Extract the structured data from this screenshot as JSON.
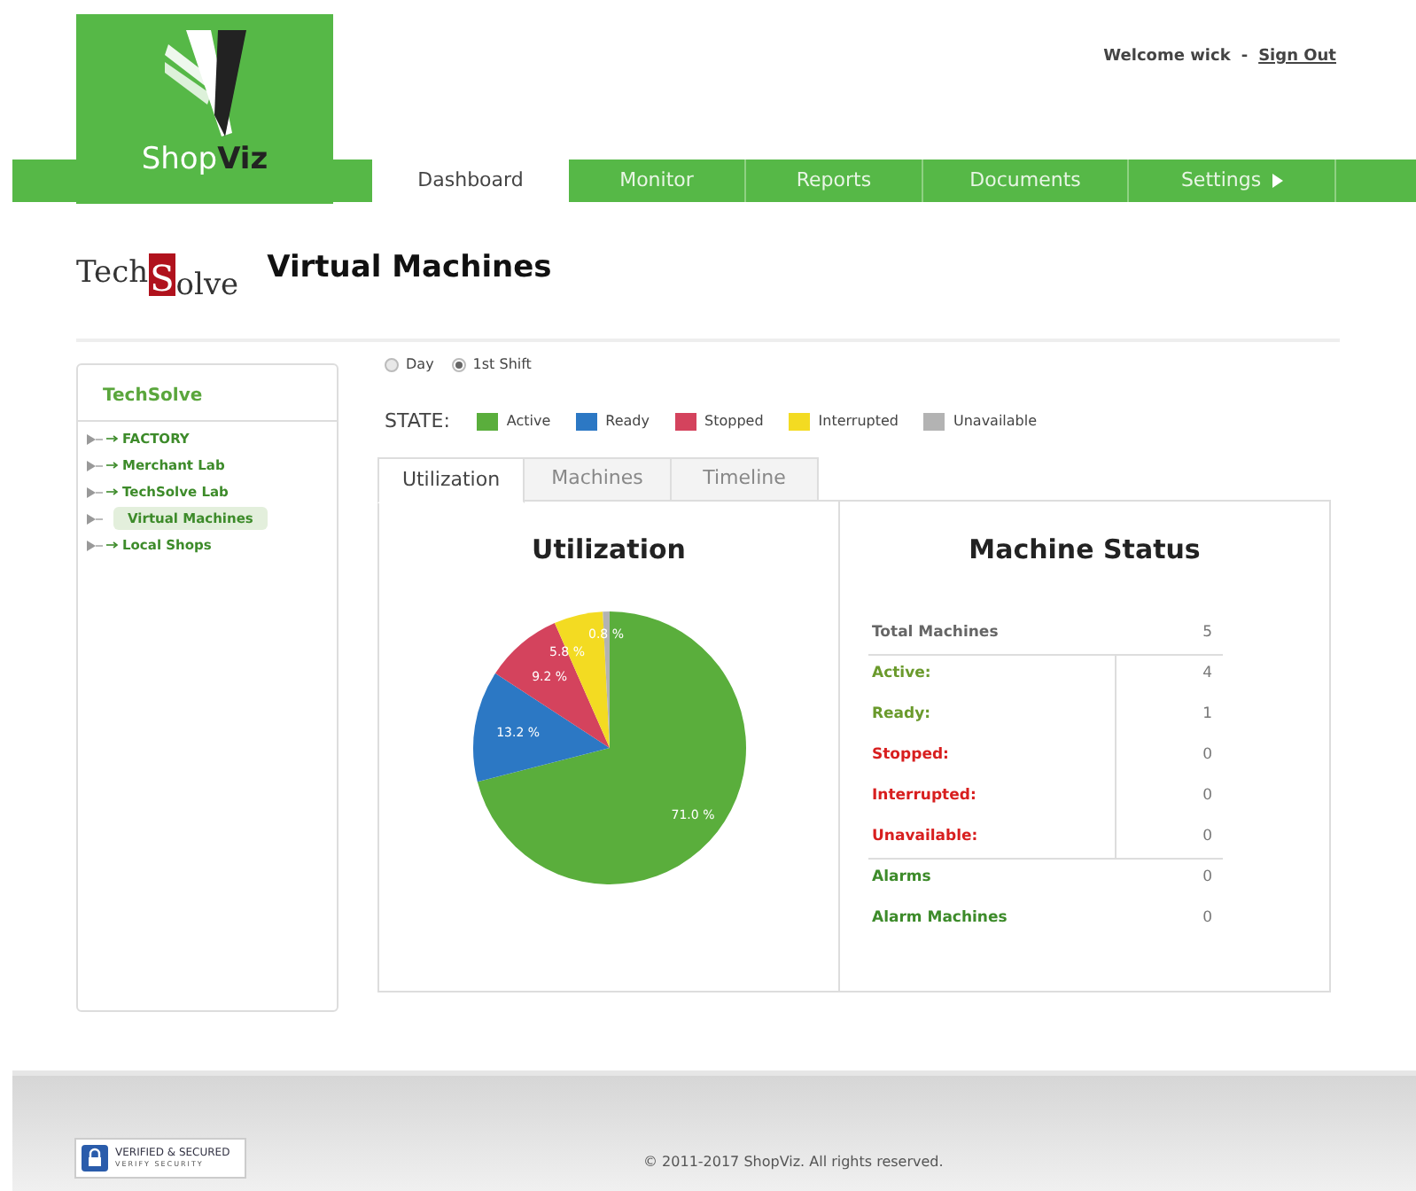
{
  "header": {
    "logo": "Shop**Viz**",
    "welcome": "Welcome wick",
    "separator": "-",
    "sign_out": "Sign Out"
  },
  "nav": [
    {
      "label": "Dashboard",
      "selected": true,
      "caret": false
    },
    {
      "label": "Monitor",
      "selected": false,
      "caret": false
    },
    {
      "label": "Reports",
      "selected": false,
      "caret": false
    },
    {
      "label": "Documents",
      "selected": false,
      "caret": false
    },
    {
      "label": "Settings",
      "selected": false,
      "caret": true
    }
  ],
  "page": {
    "company_logo": [
      "Tech",
      "S",
      "olve"
    ],
    "title": "Virtual Machines"
  },
  "sidebar": {
    "title": "TechSolve",
    "items": [
      {
        "label": "FACTORY",
        "selected": false
      },
      {
        "label": "Merchant Lab",
        "selected": false
      },
      {
        "label": "TechSolve Lab",
        "selected": false
      },
      {
        "label": "Virtual Machines",
        "selected": true
      },
      {
        "label": "Local Shops",
        "selected": false
      }
    ]
  },
  "period": [
    {
      "label": "Day",
      "selected": false
    },
    {
      "label": "1st Shift",
      "selected": true
    }
  ],
  "legend": {
    "label": "STATE:",
    "items": [
      {
        "label": "Active",
        "color": "#5aae3c"
      },
      {
        "label": "Ready",
        "color": "#2c78c4"
      },
      {
        "label": "Stopped",
        "color": "#d4435d"
      },
      {
        "label": "Interrupted",
        "color": "#f3db22"
      },
      {
        "label": "Unavailable",
        "color": "#b3b3b3"
      }
    ]
  },
  "tabs": [
    {
      "label": "Utilization",
      "selected": true
    },
    {
      "label": "Machines",
      "selected": false
    },
    {
      "label": "Timeline",
      "selected": false
    }
  ],
  "utilization": {
    "title": "Utilization",
    "chart_data": {
      "type": "pie",
      "values": [
        71.0,
        13.2,
        9.2,
        5.8,
        0.8
      ],
      "value_labels": [
        "71.0 %",
        "13.2 %",
        "9.2 %",
        "5.8 %",
        "0.8 %"
      ]
    }
  },
  "machine_status": {
    "title": "Machine Status",
    "rows": [
      {
        "label": "Total Machines",
        "value": "5",
        "kind": "total"
      },
      {
        "label": "Active:",
        "value": "4",
        "kind": "good"
      },
      {
        "label": "Ready:",
        "value": "1",
        "kind": "good"
      },
      {
        "label": "Stopped:",
        "value": "0",
        "kind": "bad"
      },
      {
        "label": "Interrupted:",
        "value": "0",
        "kind": "bad"
      },
      {
        "label": "Unavailable:",
        "value": "0",
        "kind": "bad"
      },
      {
        "label": "Alarms",
        "value": "0",
        "kind": "alarm"
      },
      {
        "label": "Alarm Machines",
        "value": "0",
        "kind": "alarm"
      }
    ]
  },
  "footer": {
    "badge": [
      "VERIFIED & SECURED",
      "VERIFY SECURITY"
    ],
    "copyright": "© 2011-2017 ShopViz. All rights reserved."
  }
}
